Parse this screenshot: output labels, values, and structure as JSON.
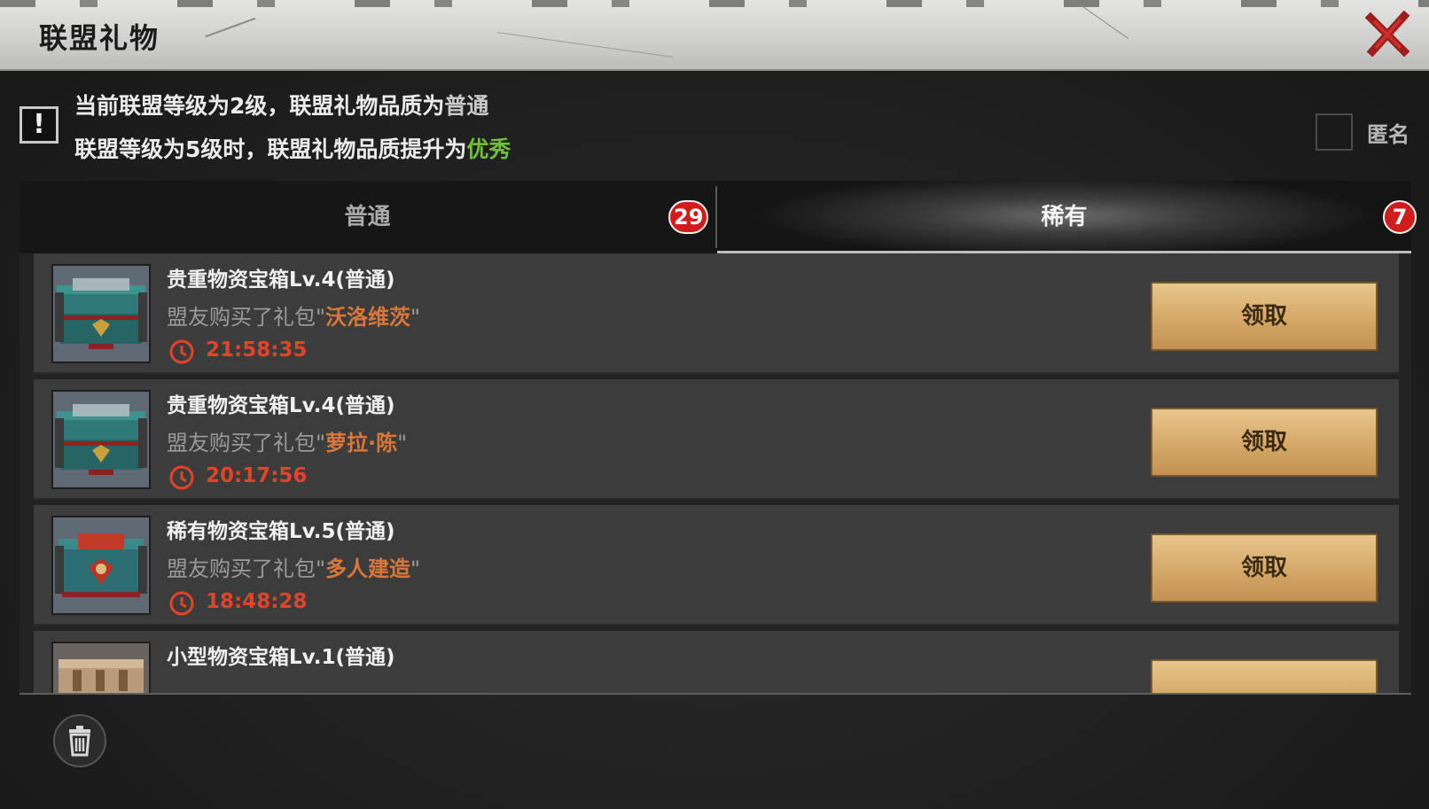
{
  "window": {
    "title": "联盟礼物",
    "close_icon": "close-x-icon"
  },
  "notice": {
    "line1_prefix": "当前联盟等级为2级，联盟礼物品质为",
    "line1_quality": "普通",
    "line2_prefix": "联盟等级为5级时，联盟礼物品质提升为",
    "line2_quality": "优秀",
    "icon_text": "!",
    "colors": {
      "normal": "#c9c9c9",
      "excellent": "#6fbf3a"
    }
  },
  "anonymous": {
    "label": "匿名",
    "checked": false
  },
  "tabs": [
    {
      "label": "普通",
      "badge": "29",
      "selected": false
    },
    {
      "label": "稀有",
      "badge": "7",
      "selected": true
    }
  ],
  "gifts": [
    {
      "name": "贵重物资宝箱Lv.4(普通)",
      "desc_prefix": "盟友购买了礼包",
      "quote_open": "\"",
      "package": "沃洛维茨",
      "quote_close": "\"",
      "time": "21:58:35",
      "button": "领取",
      "icon": "teal-chest-icon"
    },
    {
      "name": "贵重物资宝箱Lv.4(普通)",
      "desc_prefix": "盟友购买了礼包",
      "quote_open": "\"",
      "package": "萝拉·陈",
      "quote_close": "\"",
      "time": "20:17:56",
      "button": "领取",
      "icon": "teal-chest-icon"
    },
    {
      "name": "稀有物资宝箱Lv.5(普通)",
      "desc_prefix": "盟友购买了礼包",
      "quote_open": "\"",
      "package": "多人建造",
      "quote_close": "\"",
      "time": "18:48:28",
      "button": "领取",
      "icon": "rare-chest-icon"
    },
    {
      "name": "小型物资宝箱Lv.1(普通)",
      "icon": "small-crate-icon"
    }
  ],
  "footer": {
    "delete_icon": "trash-icon"
  },
  "colors": {
    "badge": "#d21b1b",
    "package_name": "#d9773a",
    "timer": "#e0452a",
    "button": "#d4a867"
  }
}
